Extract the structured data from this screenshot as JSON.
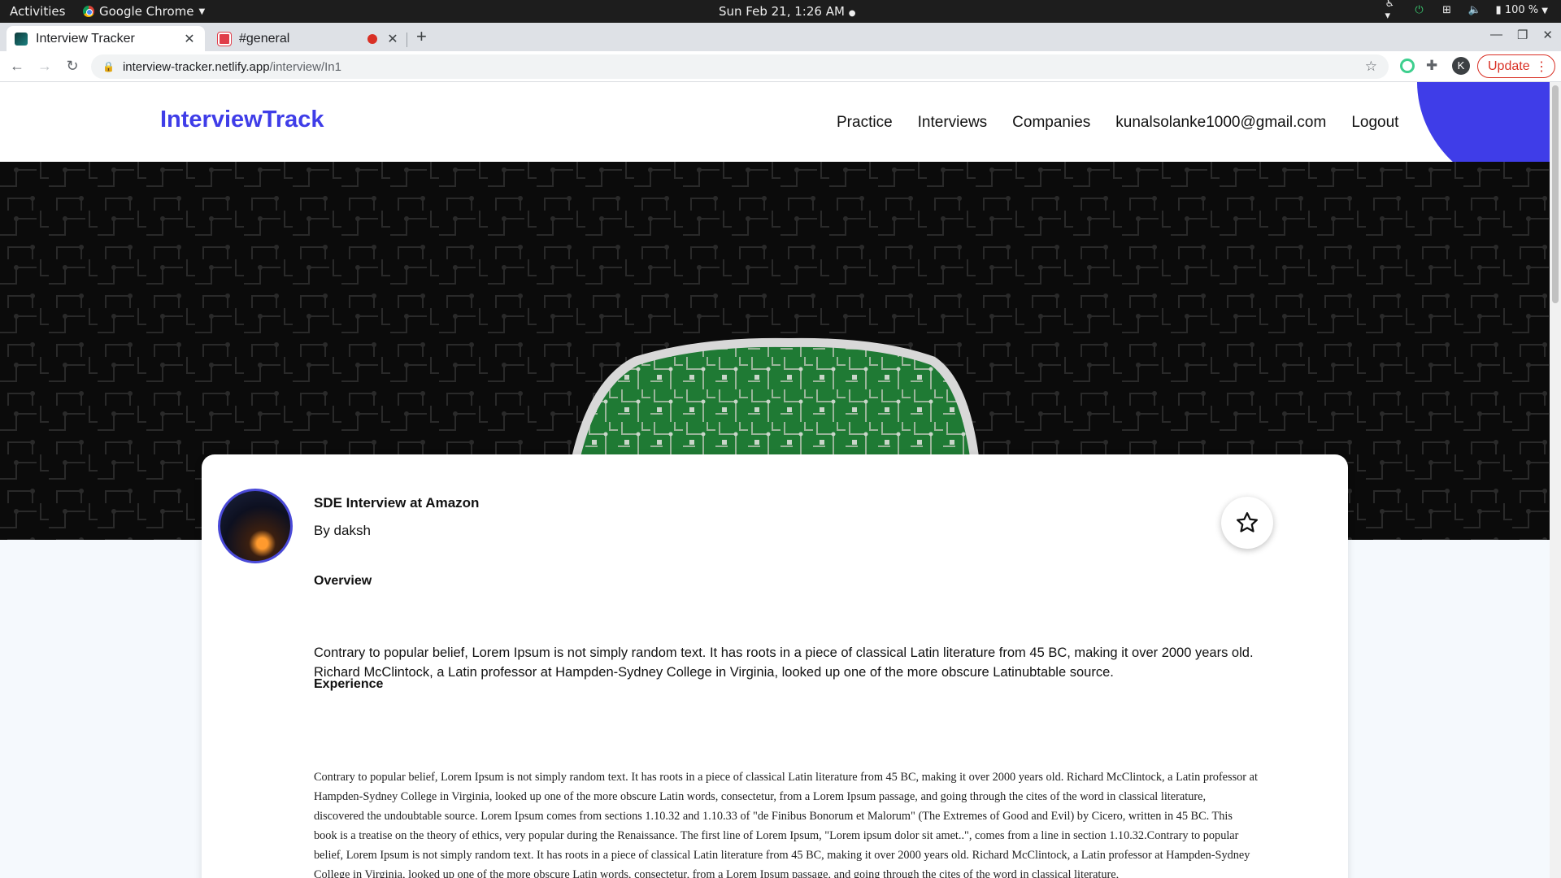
{
  "os": {
    "activities": "Activities",
    "app_name": "Google Chrome",
    "clock": "Sun Feb 21,  1:26 AM",
    "battery": "100 %"
  },
  "browser": {
    "tabs": [
      {
        "label": "Interview Tracker",
        "active": true
      },
      {
        "label": "#general",
        "active": false,
        "recording": true
      }
    ],
    "url_host": "interview-tracker.netlify.app",
    "url_path": "/interview/In1",
    "profile_initial": "K",
    "update_label": "Update"
  },
  "site": {
    "brand": "InterviewTrack",
    "nav": [
      "Practice",
      "Interviews",
      "Companies",
      "kunalsolanke1000@gmail.com",
      "Logout"
    ],
    "accent_color": "#3f3de8"
  },
  "post": {
    "title": "SDE Interview at Amazon",
    "author": "By daksh",
    "overview_heading": "Overview",
    "overview_text": "Contrary to popular belief, Lorem Ipsum is not simply random text. It has roots in a piece of classical Latin literature from 45 BC, making it over 2000 years old. Richard McClintock, a Latin professor at Hampden-Sydney College in Virginia, looked up one of the more obscure Latinubtable source.",
    "experience_heading": "Experience",
    "experience_text": "Contrary to popular belief, Lorem Ipsum is not simply random text. It has roots in a piece of classical Latin literature from 45 BC, making it over 2000 years old. Richard McClintock, a Latin professor at Hampden-Sydney College in Virginia, looked up one of the more obscure Latin words, consectetur, from a Lorem Ipsum passage, and going through the cites of the word in classical literature, discovered the undoubtable source. Lorem Ipsum comes from sections 1.10.32 and 1.10.33 of \"de Finibus Bonorum et Malorum\" (The Extremes of Good and Evil) by Cicero, written in 45 BC. This book is a treatise on the theory of ethics, very popular during the Renaissance. The first line of Lorem Ipsum, \"Lorem ipsum dolor sit amet..\", comes from a line in section 1.10.32.Contrary to popular belief, Lorem Ipsum is not simply random text. It has roots in a piece of classical Latin literature from 45 BC, making it over 2000 years old. Richard McClintock, a Latin professor at Hampden-Sydney College in Virginia, looked up one of the more obscure Latin words, consectetur, from a Lorem Ipsum passage, and going through the cites of the word in classical literature,"
  },
  "icons": {
    "favorite": "star-outline-icon",
    "hero": "circuit-board-mask-image"
  }
}
